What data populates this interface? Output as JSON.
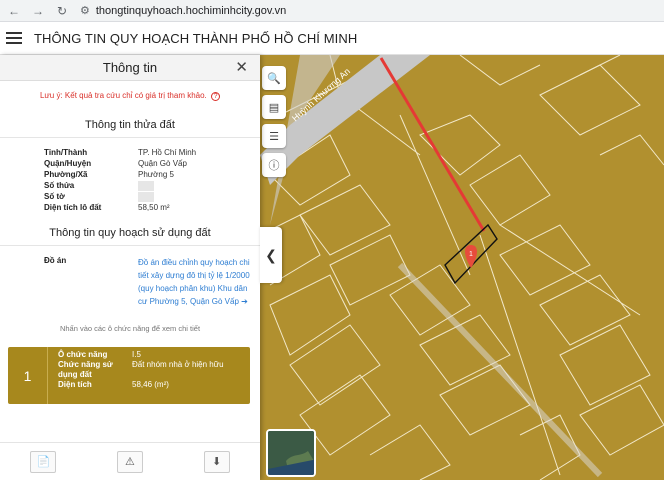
{
  "browser": {
    "url": "thongtinquyhoach.hochiminhcity.gov.vn",
    "back_icon": "arrow-left-icon",
    "forward_icon": "arrow-right-icon",
    "reload_icon": "reload-icon"
  },
  "app": {
    "title": "THÔNG TIN QUY HOẠCH THÀNH PHỐ HỒ CHÍ MINH"
  },
  "panel": {
    "title": "Thông tin",
    "close": "✕",
    "note": "Lưu ý: Kết quả tra cứu chỉ có giá trị tham khảo.",
    "note_icon": "?",
    "land_section": "Thông tin thửa đất",
    "land": [
      {
        "k": "Tỉnh/Thành",
        "v": "TP. Hồ Chí Minh"
      },
      {
        "k": "Quận/Huyện",
        "v": "Quận Gò Vấp"
      },
      {
        "k": "Phường/Xã",
        "v": "Phường 5"
      },
      {
        "k": "Số thửa",
        "v": ""
      },
      {
        "k": "Số tờ",
        "v": ""
      },
      {
        "k": "Diện tích lô đất",
        "v": "58,50 m²"
      }
    ],
    "plan_section": "Thông tin quy hoạch sử dụng đất",
    "plan_label": "Đồ án",
    "plan_link": "Đồ án điều chỉnh quy hoạch chi tiết xây dựng đô thị tỷ lệ 1/2000 (quy hoạch phân khu) Khu dân cư Phường 5, Quận Gò Vấp ➔",
    "hint": "Nhấn vào các ô chức năng để xem chi tiết",
    "card": {
      "num": "1",
      "rows": [
        {
          "k": "Ô chức năng",
          "v": "I.5"
        },
        {
          "k": "Chức năng sử dụng đất",
          "v": "Đất nhóm nhà ở hiện hữu"
        },
        {
          "k": "Diện tích",
          "v": "58,46 (m²)"
        }
      ]
    }
  },
  "map": {
    "street_label": "Huỳnh Khương An",
    "marker_label": "1",
    "land_color": "#b1902f",
    "road_color": "#e53935"
  }
}
